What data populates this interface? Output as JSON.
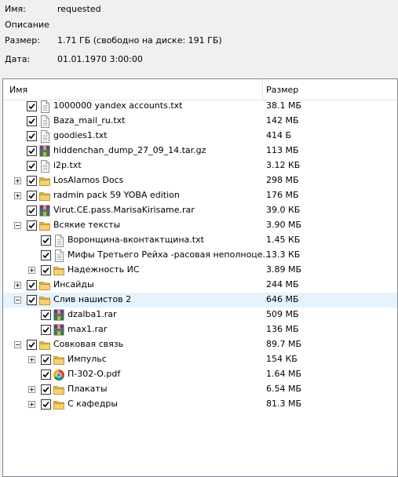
{
  "properties": {
    "name_label": "Имя:",
    "name_value": "requested",
    "description_label": "Описание",
    "size_label": "Размер:",
    "size_value": "1.71 ГБ (свободно на диске: 191 ГБ)",
    "date_label": "Дата:",
    "date_value": "01.01.1970 3:00:00"
  },
  "columns": {
    "name": "Имя",
    "size": "Размер"
  },
  "rows": [
    {
      "name": "1000000 yandex accounts.txt",
      "size": "38.1 МБ",
      "level": 1,
      "icon": "text-file-icon",
      "expander": "none",
      "checked": true
    },
    {
      "name": "Baza_mail_ru.txt",
      "size": "142 МБ",
      "level": 1,
      "icon": "text-file-icon",
      "expander": "none",
      "checked": true
    },
    {
      "name": "goodies1.txt",
      "size": "414 Б",
      "level": 1,
      "icon": "text-file-icon",
      "expander": "none",
      "checked": true
    },
    {
      "name": "hiddenchan_dump_27_09_14.tar.gz",
      "size": "113 МБ",
      "level": 1,
      "icon": "archive-icon",
      "expander": "none",
      "checked": true
    },
    {
      "name": "i2p.txt",
      "size": "3.12 КБ",
      "level": 1,
      "icon": "text-file-icon",
      "expander": "none",
      "checked": true
    },
    {
      "name": "LosAlamos Docs",
      "size": "298 МБ",
      "level": 1,
      "icon": "folder-icon",
      "expander": "plus",
      "checked": true
    },
    {
      "name": "radmin pack 59 YOBA edition",
      "size": "176 МБ",
      "level": 1,
      "icon": "folder-icon",
      "expander": "plus",
      "checked": true
    },
    {
      "name": "Virut.CE.pass.MarisaKirisame.rar",
      "size": "39.0 КБ",
      "level": 1,
      "icon": "archive-icon",
      "expander": "none",
      "checked": true
    },
    {
      "name": "Всякие тексты",
      "size": "3.90 МБ",
      "level": 1,
      "icon": "folder-icon",
      "expander": "minus",
      "checked": true
    },
    {
      "name": "Воронщина-вконтактщина.txt",
      "size": "1.45 КБ",
      "level": 2,
      "icon": "text-file-icon",
      "expander": "none",
      "checked": true
    },
    {
      "name": "Мифы Третьего Рейха -расовая неполноце...",
      "size": "13.3 КБ",
      "level": 2,
      "icon": "text-file-icon",
      "expander": "none",
      "checked": true
    },
    {
      "name": "Надежность ИС",
      "size": "3.89 МБ",
      "level": 2,
      "icon": "folder-icon",
      "expander": "plus",
      "checked": true
    },
    {
      "name": "Инсайды",
      "size": "244 МБ",
      "level": 1,
      "icon": "folder-icon",
      "expander": "plus",
      "checked": true
    },
    {
      "name": "Слив нашистов 2",
      "size": "646 МБ",
      "level": 1,
      "icon": "folder-icon",
      "expander": "minus",
      "checked": true,
      "selected": true
    },
    {
      "name": "dzalba1.rar",
      "size": "509 МБ",
      "level": 2,
      "icon": "archive-icon",
      "expander": "none",
      "checked": true
    },
    {
      "name": "max1.rar",
      "size": "136 МБ",
      "level": 2,
      "icon": "archive-icon",
      "expander": "none",
      "checked": true
    },
    {
      "name": "Совковая связь",
      "size": "89.7 МБ",
      "level": 1,
      "icon": "folder-icon",
      "expander": "minus",
      "checked": true
    },
    {
      "name": "Импульс",
      "size": "154 КБ",
      "level": 2,
      "icon": "folder-icon",
      "expander": "plus",
      "checked": true
    },
    {
      "name": "П-302-О.pdf",
      "size": "1.64 МБ",
      "level": 2,
      "icon": "chrome-pdf-icon",
      "expander": "none",
      "checked": true
    },
    {
      "name": "Плакаты",
      "size": "6.54 МБ",
      "level": 2,
      "icon": "folder-icon",
      "expander": "plus",
      "checked": true
    },
    {
      "name": "С кафедры",
      "size": "81.3 МБ",
      "level": 2,
      "icon": "folder-icon",
      "expander": "plus",
      "checked": true
    }
  ]
}
